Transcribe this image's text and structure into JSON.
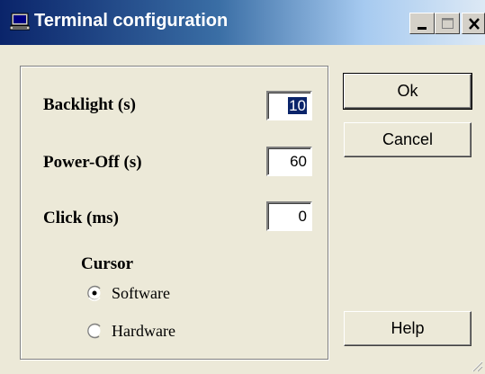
{
  "window": {
    "title": "Terminal configuration",
    "icon": "terminal-icon"
  },
  "fields": [
    {
      "label": "Backlight (s)",
      "value": "10",
      "selected": true
    },
    {
      "label": "Power-Off (s)",
      "value": "60",
      "selected": false
    },
    {
      "label": "Click (ms)",
      "value": "0",
      "selected": false
    }
  ],
  "cursor": {
    "heading": "Cursor",
    "options": [
      {
        "label": "Software",
        "checked": true
      },
      {
        "label": "Hardware",
        "checked": false
      }
    ]
  },
  "buttons": {
    "ok": "Ok",
    "cancel": "Cancel",
    "help": "Help"
  }
}
